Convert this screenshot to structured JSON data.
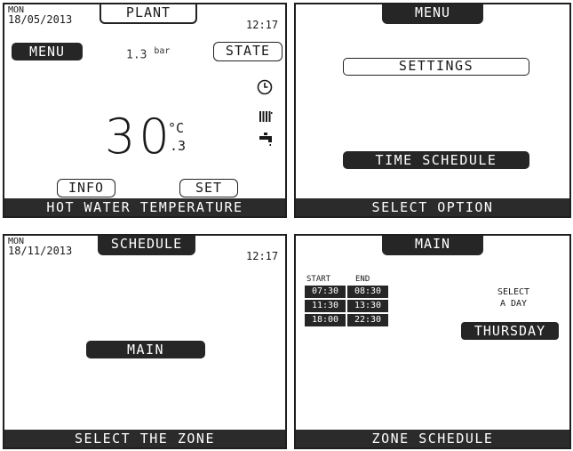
{
  "screen1": {
    "date_day": "MON",
    "date": "18/05/2013",
    "title": "PLANT",
    "time": "12:17",
    "menu_button": "MENU",
    "pressure_value": "1.3",
    "pressure_unit": "bar",
    "state_button": "STATE",
    "temperature_int": "30",
    "temperature_unit": "°C",
    "temperature_dec": ".3",
    "info_button": "INFO",
    "set_button": "SET",
    "footer": "HOT WATER TEMPERATURE",
    "icons": [
      "clock-icon",
      "radiator-icon",
      "tap-icon"
    ]
  },
  "screen2": {
    "title": "MENU",
    "settings_button": "SETTINGS",
    "time_schedule_button": "TIME SCHEDULE",
    "footer": "SELECT OPTION"
  },
  "screen3": {
    "date_day": "MON",
    "date": "18/11/2013",
    "title": "SCHEDULE",
    "time": "12:17",
    "zone_button": "MAIN",
    "footer": "SELECT THE ZONE"
  },
  "screen4": {
    "title": "MAIN",
    "col_start": "START",
    "col_end": "END",
    "rows": [
      {
        "start": "07:30",
        "end": "08:30"
      },
      {
        "start": "11:30",
        "end": "13:30"
      },
      {
        "start": "18:00",
        "end": "22:30"
      }
    ],
    "select_line1": "SELECT",
    "select_line2": "A DAY",
    "day_button": "THURSDAY",
    "footer": "ZONE SCHEDULE"
  }
}
